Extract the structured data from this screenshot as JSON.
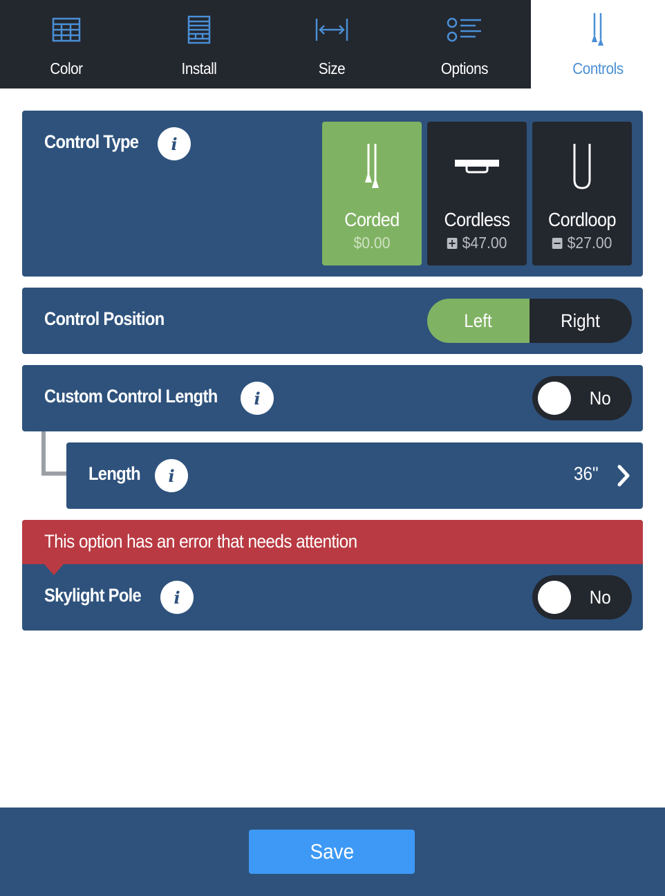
{
  "tabs": [
    {
      "label": "Color",
      "icon": "grid-icon",
      "active": false
    },
    {
      "label": "Install",
      "icon": "window-frame-icon",
      "active": false
    },
    {
      "label": "Size",
      "icon": "width-arrows-icon",
      "active": false
    },
    {
      "label": "Options",
      "icon": "options-list-icon",
      "active": false
    },
    {
      "label": "Controls",
      "icon": "cord-tassel-icon",
      "active": true
    }
  ],
  "control_type": {
    "title": "Control Type",
    "info_label": "i",
    "options": [
      {
        "name": "Corded",
        "price": "$0.00",
        "price_sign": "",
        "selected": true,
        "icon": "corded-icon"
      },
      {
        "name": "Cordless",
        "price": "$47.00",
        "price_sign": "plus",
        "selected": false,
        "icon": "cordless-icon"
      },
      {
        "name": "Cordloop",
        "price": "$27.00",
        "price_sign": "minus",
        "selected": false,
        "icon": "cordloop-icon"
      }
    ]
  },
  "control_position": {
    "title": "Control Position",
    "options": [
      "Left",
      "Right"
    ],
    "selected": "Left"
  },
  "custom_control_length": {
    "title": "Custom Control Length",
    "info_label": "i",
    "toggle_value": "No"
  },
  "length": {
    "title": "Length",
    "info_label": "i",
    "value": "36\""
  },
  "error": {
    "message": "This option has an error that needs attention"
  },
  "skylight_pole": {
    "title": "Skylight Pole",
    "info_label": "i",
    "toggle_value": "No"
  },
  "footer": {
    "save_label": "Save"
  },
  "colors": {
    "tabbar_bg": "#23272e",
    "panel_bg": "#2e527c",
    "selected_green": "#80b263",
    "error_red": "#b93a42",
    "active_tab_text": "#4a8fd6",
    "save_blue": "#3d99f5"
  }
}
